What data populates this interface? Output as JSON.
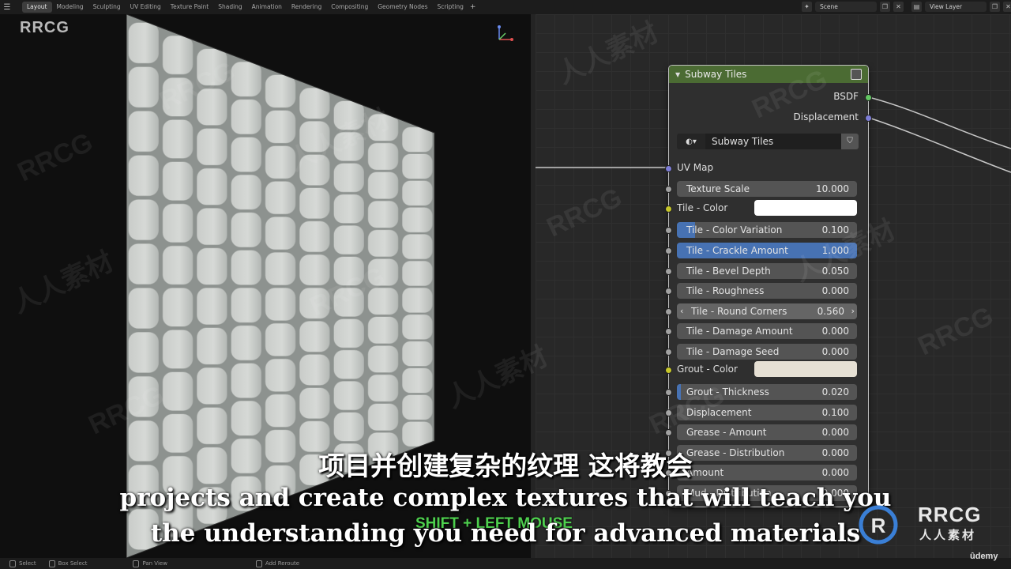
{
  "topbar": {
    "tabs": [
      "Layout",
      "Modeling",
      "Sculpting",
      "UV Editing",
      "Texture Paint",
      "Shading",
      "Animation",
      "Rendering",
      "Compositing",
      "Geometry Nodes",
      "Scripting"
    ],
    "active_tab": "Layout",
    "scene": "Scene",
    "view_layer": "View Layer"
  },
  "viewport": {
    "logo": "RRCG"
  },
  "node": {
    "title": "Subway Tiles",
    "outputs": [
      "BSDF",
      "Displacement"
    ],
    "datablock": "Subway Tiles",
    "uv_map_label": "UV Map",
    "tile_color_label": "Tile - Color",
    "grout_color_label": "Grout - Color",
    "tile_color": "#ffffff",
    "grout_color": "#e6e0d4",
    "fields": [
      {
        "label": "Texture Scale",
        "value": "10.000"
      },
      {
        "label": "Tile - Color Variation",
        "value": "0.100",
        "fill": 0.1
      },
      {
        "label": "Tile - Crackle Amount",
        "value": "1.000",
        "fill": 1.0
      },
      {
        "label": "Tile - Bevel Depth",
        "value": "0.050"
      },
      {
        "label": "Tile - Roughness",
        "value": "0.000"
      },
      {
        "label": "Tile - Round Corners",
        "value": "0.560"
      },
      {
        "label": "Tile - Damage Amount",
        "value": "0.000"
      },
      {
        "label": "Tile - Damage Seed",
        "value": "0.000"
      },
      {
        "label": "Grout - Thickness",
        "value": "0.020",
        "fill": 0.02
      },
      {
        "label": "Displacement",
        "value": "0.100"
      },
      {
        "label": "Grease - Amount",
        "value": "0.000"
      },
      {
        "label": "Grease - Distribution",
        "value": "0.000"
      },
      {
        "label": "Amount",
        "value": "0.000"
      },
      {
        "label": "Mud - Distribution",
        "value": "0.000"
      }
    ]
  },
  "statusbar": {
    "items": [
      "Select",
      "Box Select",
      "Pan View",
      "Add Reroute"
    ]
  },
  "overlay": {
    "subtitle_cn": "项目并创建复杂的纹理 这将教会",
    "subtitle_en_1": "projects and create complex textures that will teach you",
    "subtitle_en_2": "the understanding you need for advanced materials",
    "key_hint": "SHIFT + LEFT MOUSE",
    "brand_text": "RRCG",
    "brand_sub": "人人素材",
    "udemy": "ûdemy",
    "watermark_latin": "RRCG",
    "watermark_cn": "人人素材"
  },
  "colors": {
    "node_header": "#4b6b33",
    "field_fill": "#4772b3",
    "socket_green": "#63c763",
    "socket_purple": "#7e7ed8",
    "socket_yellow": "#c7c729",
    "socket_gray": "#a1a1a1",
    "key_hint": "#4ed04e"
  }
}
